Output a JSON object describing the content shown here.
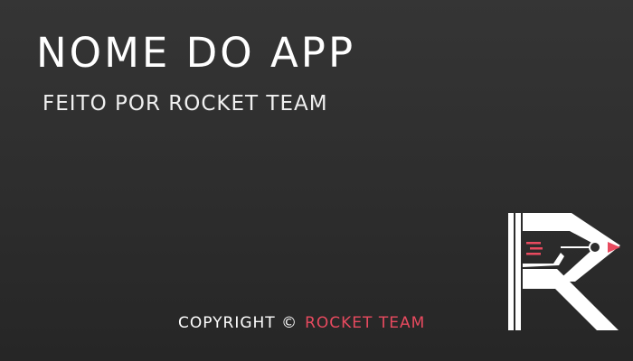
{
  "header": {
    "title": "NOME DO APP",
    "subtitle": "FEITO POR ROCKET TEAM"
  },
  "footer": {
    "copyright_label": "COPYRIGHT ©",
    "brand": "ROCKET TEAM"
  },
  "logo": {
    "icon": "rocket-team-r-logo-icon",
    "colors": {
      "primary": "#ffffff",
      "accent": "#e84a5f"
    }
  },
  "colors": {
    "background": "#2c2c2c",
    "text": "#ffffff",
    "accent": "#e84a5f"
  }
}
